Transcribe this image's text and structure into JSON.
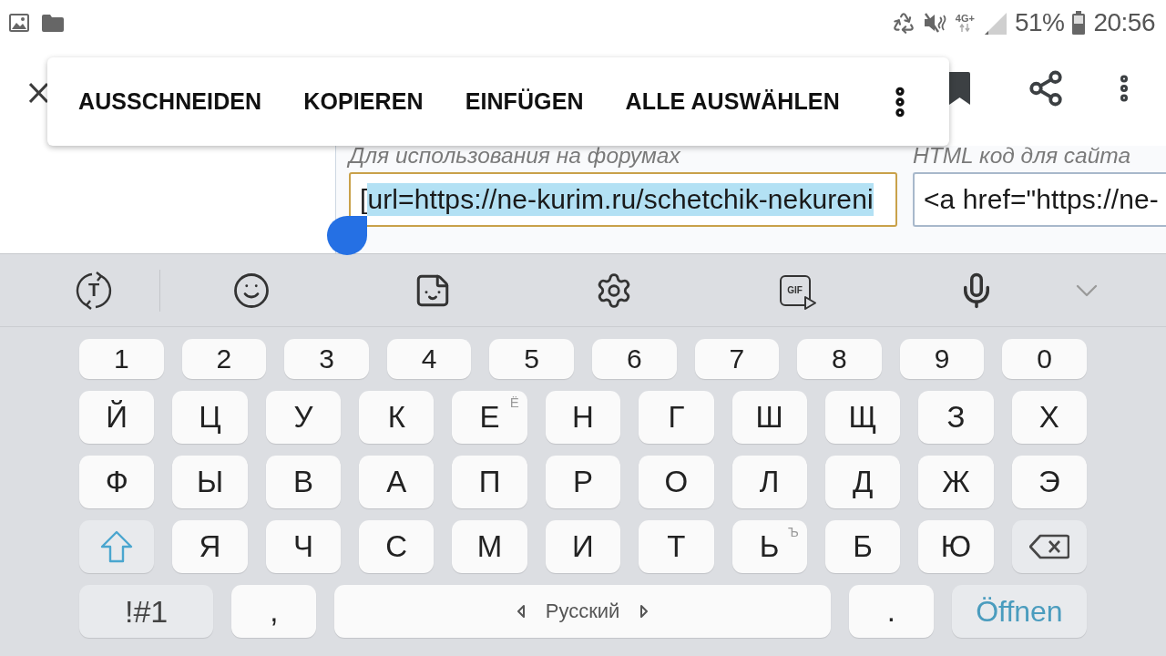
{
  "status_bar": {
    "network_type": "4G+",
    "battery": "51%",
    "time": "20:56"
  },
  "selection_menu": {
    "items": [
      "AUSSCHNEIDEN",
      "KOPIEREN",
      "EINFÜGEN",
      "ALLE AUSWÄHLEN"
    ]
  },
  "embed_fields": [
    {
      "label": "Для использования на форумах",
      "focused": true,
      "value_parts": [
        {
          "text": "[",
          "selected": false
        },
        {
          "text": "url=https://ne-kurim.ru/schetchik-nekureni",
          "selected": true
        }
      ]
    },
    {
      "label": "HTML код для сайта",
      "focused": false,
      "value_parts": [
        {
          "text": "<a href=\"https://ne-",
          "selected": false
        }
      ]
    }
  ],
  "keyboard": {
    "toolbar": {
      "translate_letter": "T",
      "gif_label": "GIF"
    },
    "rows": [
      {
        "kind": "numbers",
        "keys": [
          {
            "kind": "char",
            "label": "1"
          },
          {
            "kind": "char",
            "label": "2"
          },
          {
            "kind": "char",
            "label": "3"
          },
          {
            "kind": "char",
            "label": "4"
          },
          {
            "kind": "char",
            "label": "5"
          },
          {
            "kind": "char",
            "label": "6"
          },
          {
            "kind": "char",
            "label": "7"
          },
          {
            "kind": "char",
            "label": "8"
          },
          {
            "kind": "char",
            "label": "9"
          },
          {
            "kind": "char",
            "label": "0"
          }
        ]
      },
      {
        "kind": "letters",
        "keys": [
          {
            "kind": "char",
            "label": "Й"
          },
          {
            "kind": "char",
            "label": "Ц"
          },
          {
            "kind": "char",
            "label": "У"
          },
          {
            "kind": "char",
            "label": "К"
          },
          {
            "kind": "char",
            "label": "Е",
            "hint": "Ё"
          },
          {
            "kind": "char",
            "label": "Н"
          },
          {
            "kind": "char",
            "label": "Г"
          },
          {
            "kind": "char",
            "label": "Ш"
          },
          {
            "kind": "char",
            "label": "Щ"
          },
          {
            "kind": "char",
            "label": "З"
          },
          {
            "kind": "char",
            "label": "Х"
          }
        ]
      },
      {
        "kind": "letters",
        "keys": [
          {
            "kind": "char",
            "label": "Ф"
          },
          {
            "kind": "char",
            "label": "Ы"
          },
          {
            "kind": "char",
            "label": "В"
          },
          {
            "kind": "char",
            "label": "А"
          },
          {
            "kind": "char",
            "label": "П"
          },
          {
            "kind": "char",
            "label": "Р"
          },
          {
            "kind": "char",
            "label": "О"
          },
          {
            "kind": "char",
            "label": "Л"
          },
          {
            "kind": "char",
            "label": "Д"
          },
          {
            "kind": "char",
            "label": "Ж"
          },
          {
            "kind": "char",
            "label": "Э"
          }
        ]
      },
      {
        "kind": "letters",
        "keys": [
          {
            "kind": "shift"
          },
          {
            "kind": "char",
            "label": "Я"
          },
          {
            "kind": "char",
            "label": "Ч"
          },
          {
            "kind": "char",
            "label": "С"
          },
          {
            "kind": "char",
            "label": "М"
          },
          {
            "kind": "char",
            "label": "И"
          },
          {
            "kind": "char",
            "label": "Т"
          },
          {
            "kind": "char",
            "label": "Ь",
            "hint": "Ъ"
          },
          {
            "kind": "char",
            "label": "Б"
          },
          {
            "kind": "char",
            "label": "Ю"
          },
          {
            "kind": "backspace"
          }
        ]
      },
      {
        "kind": "bottom",
        "keys": [
          {
            "kind": "symbols",
            "label": "!#1"
          },
          {
            "kind": "char",
            "label": ","
          },
          {
            "kind": "space",
            "label": "Русский"
          },
          {
            "kind": "char",
            "label": "."
          },
          {
            "kind": "action",
            "label": "Öffnen"
          }
        ]
      }
    ]
  }
}
